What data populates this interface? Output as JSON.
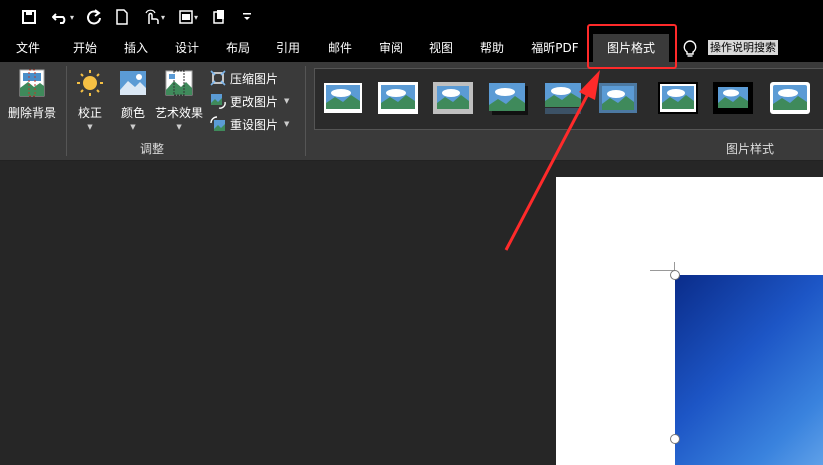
{
  "quick_access": {
    "save_icon": "save-icon",
    "undo_icon": "undo-icon",
    "redo_icon": "redo-icon",
    "new_icon": "new-document-icon",
    "touch_icon": "touch-mode-icon",
    "layout_icon": "layout-icon",
    "copy_icon": "copy-icon",
    "customize_icon": "customize-qat-icon"
  },
  "tabs": [
    {
      "label": "文件"
    },
    {
      "label": "开始"
    },
    {
      "label": "插入"
    },
    {
      "label": "设计"
    },
    {
      "label": "布局"
    },
    {
      "label": "引用"
    },
    {
      "label": "邮件"
    },
    {
      "label": "审阅"
    },
    {
      "label": "视图"
    },
    {
      "label": "帮助"
    },
    {
      "label": "福昕PDF"
    },
    {
      "label": "图片格式"
    }
  ],
  "active_tab": "图片格式",
  "tell_me": "操作说明搜索",
  "ribbon": {
    "remove_background": "删除背景",
    "corrections": "校正",
    "color": "颜色",
    "artistic_effects": "艺术效果",
    "compress": "压缩图片",
    "change_picture": "更改图片",
    "reset_picture": "重设图片",
    "adjust_group": "调整",
    "styles_group": "图片样式"
  },
  "colors": {
    "highlight": "#ff2a2a",
    "ribbon_bg": "#3a3a3a",
    "title_bg": "#000000",
    "canvas_bg": "#262626"
  }
}
